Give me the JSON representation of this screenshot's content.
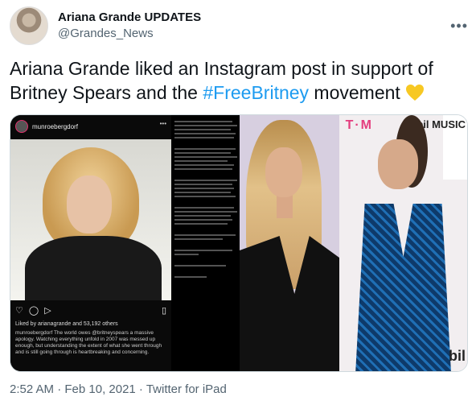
{
  "author": {
    "display_name": "Ariana Grande UPDATES",
    "handle": "@Grandes_News",
    "more_icon": "more-horizontal-icon"
  },
  "tweet": {
    "text_before": "Ariana Grande liked an Instagram post in support of Britney Spears and the ",
    "hashtag": "#FreeBritney",
    "text_after": " movement ",
    "emoji": "yellow-heart-icon",
    "hashtag_color": "#1d9bf0"
  },
  "media": {
    "instagram_post": {
      "username": "munroebergdorf",
      "likes": "Liked by arianagrande and 53,192 others",
      "caption": "munroebergdorf The world owes @britneyspears a massive apology. Watching everything unfold in 2007 was messed up enough, but understanding the extent of what she went through and is still going through is heartbreaking and concerning."
    },
    "photo_left_signage": "T·M",
    "photo_right_signage_top": "bil MUSIC",
    "photo_right_signage_bottom": "bil"
  },
  "meta": {
    "timestamp": "2:52 AM · Feb 10, 2021 · Twitter for iPad"
  }
}
